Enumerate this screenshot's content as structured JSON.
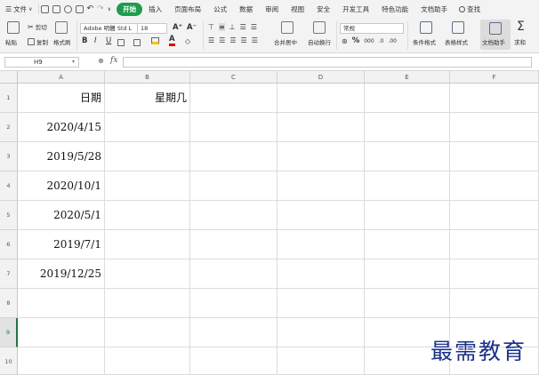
{
  "menubar": {
    "file_label": "文件",
    "tabs": [
      "开始",
      "插入",
      "页面布局",
      "公式",
      "数据",
      "审阅",
      "视图",
      "安全",
      "开发工具",
      "特色功能",
      "文档助手"
    ],
    "active_tab": "开始",
    "search_label": "查找"
  },
  "toolbar": {
    "paste_label": "粘贴",
    "cut_label": "剪切",
    "copy_label": "复制",
    "format_painter_label": "格式刷",
    "font_name": "Adobe 明體 Std L",
    "font_size": "18",
    "bold": "B",
    "italic": "I",
    "underline": "U",
    "grow_font": "A⁺",
    "shrink_font": "A⁻",
    "font_color": "A",
    "merge_center_label": "合并居中",
    "wrap_label": "自动换行",
    "number_format": "常规",
    "percent": "%",
    "thousands": "000",
    "conditional_label": "条件格式",
    "table_style_label": "表格样式",
    "doc_assist_label": "文档助手",
    "sum_label": "求和"
  },
  "formula_bar": {
    "name_box": "H9",
    "fx": "fx",
    "value": ""
  },
  "columns": [
    "A",
    "B",
    "C",
    "D",
    "E",
    "F"
  ],
  "rows": [
    "1",
    "2",
    "3",
    "4",
    "5",
    "6",
    "7",
    "8",
    "9",
    "10"
  ],
  "selected_row": "9",
  "cells": {
    "A1": "日期",
    "B1": "星期几",
    "A2": "2020/4/15",
    "A3": "2019/5/28",
    "A4": "2020/10/1",
    "A5": "2020/5/1",
    "A6": "2019/7/1",
    "A7": "2019/12/25"
  },
  "watermark": "最需教育",
  "colors": {
    "active_tab": "#1f9c4b",
    "selection": "#217346",
    "watermark": "#1a2f8a"
  }
}
